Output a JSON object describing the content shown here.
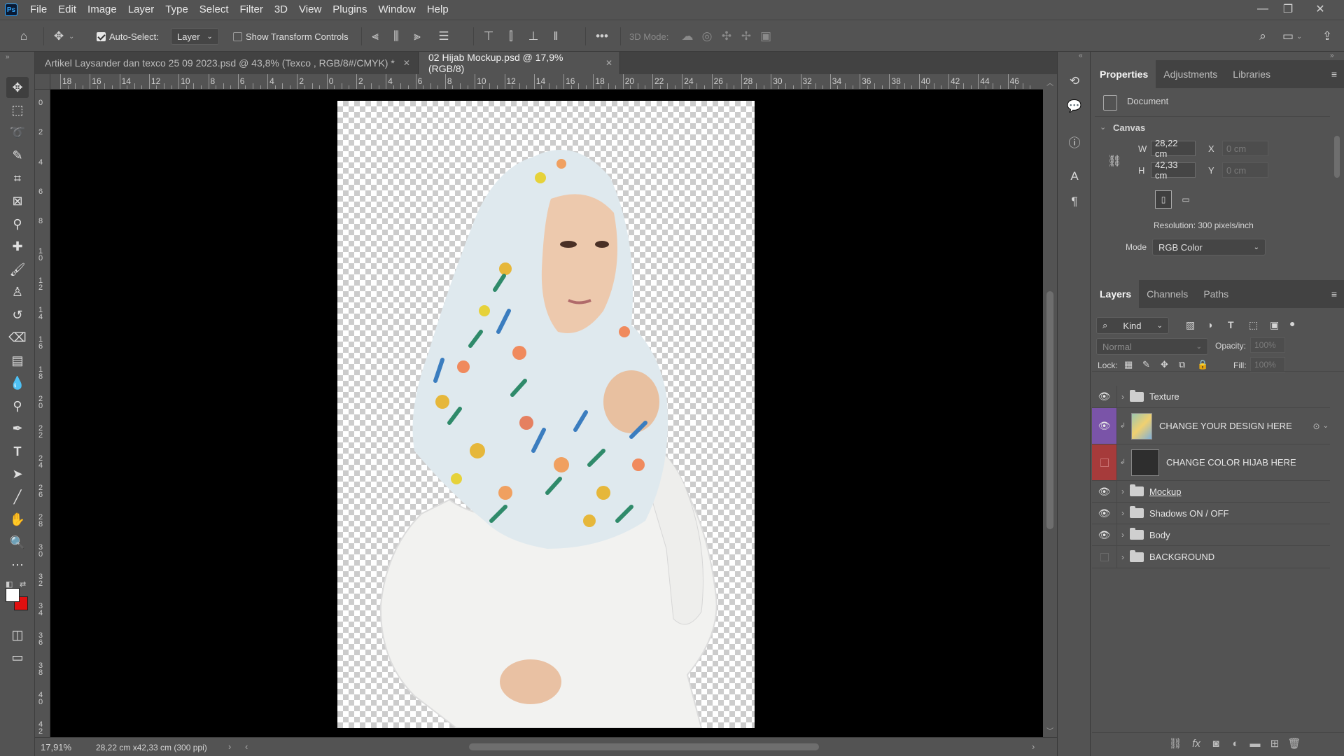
{
  "menubar": {
    "logo": "Ps",
    "items": [
      "File",
      "Edit",
      "Image",
      "Layer",
      "Type",
      "Select",
      "Filter",
      "3D",
      "View",
      "Plugins",
      "Window",
      "Help"
    ]
  },
  "options_bar": {
    "auto_select_label": "Auto-Select:",
    "auto_select_checked": true,
    "auto_select_target": "Layer",
    "show_transform_label": "Show Transform Controls",
    "show_transform_checked": false,
    "more_label": "•••",
    "mode_3d_label": "3D Mode:"
  },
  "tabs": [
    {
      "label": "Artikel Laysander dan texco 25 09 2023.psd @ 43,8% (Texco , RGB/8#/CMYK) *",
      "active": false
    },
    {
      "label": "02 Hijab Mockup.psd @ 17,9% (RGB/8)",
      "active": true
    }
  ],
  "ruler_top": [
    "18",
    "16",
    "14",
    "12",
    "10",
    "8",
    "6",
    "4",
    "2",
    "0",
    "2",
    "4",
    "6",
    "8",
    "10",
    "12",
    "14",
    "16",
    "18",
    "20",
    "22",
    "24",
    "26",
    "28",
    "30",
    "32",
    "34",
    "36",
    "38",
    "40",
    "42",
    "44",
    "46"
  ],
  "ruler_left": [
    "0",
    "2",
    "4",
    "6",
    "8",
    "1 0",
    "1 2",
    "1 4",
    "1 6",
    "1 8",
    "2 0",
    "2 2",
    "2 4",
    "2 6",
    "2 8",
    "3 0",
    "3 2",
    "3 4",
    "3 6",
    "3 8",
    "4 0",
    "4 2"
  ],
  "status": {
    "zoom": "17,91%",
    "doc_info": "28,22 cm x42,33 cm (300 ppi)"
  },
  "properties": {
    "tabs": [
      "Properties",
      "Adjustments",
      "Libraries"
    ],
    "document_label": "Document",
    "canvas_section": "Canvas",
    "w_label": "W",
    "w_value": "28,22 cm",
    "h_label": "H",
    "h_value": "42,33 cm",
    "x_label": "X",
    "x_placeholder": "0 cm",
    "y_label": "Y",
    "y_placeholder": "0 cm",
    "resolution": "Resolution: 300 pixels/inch",
    "mode_label": "Mode",
    "mode_value": "RGB Color"
  },
  "layers_panel": {
    "tabs": [
      "Layers",
      "Channels",
      "Paths"
    ],
    "filter_kind": "Kind",
    "blend_mode": "Normal",
    "opacity_label": "Opacity:",
    "opacity_value": "100%",
    "lock_label": "Lock:",
    "fill_label": "Fill:",
    "fill_value": "100%",
    "layers": [
      {
        "name": "Texture",
        "type": "group",
        "visible": true
      },
      {
        "name": "CHANGE YOUR DESIGN HERE",
        "type": "smart",
        "visible": true,
        "color": "#7a54a8"
      },
      {
        "name": "CHANGE COLOR HIJAB HERE",
        "type": "fill",
        "visible": false,
        "color": "#a63b3b"
      },
      {
        "name": "Mockup",
        "type": "group",
        "visible": true
      },
      {
        "name": "Shadows ON / OFF",
        "type": "group",
        "visible": true
      },
      {
        "name": "Body",
        "type": "group",
        "visible": true
      },
      {
        "name": "BACKGROUND",
        "type": "group",
        "visible": false
      }
    ]
  },
  "colors": {
    "accent_blue": "#31a8ff",
    "foreground": "#ffffff",
    "background": "#e01010"
  }
}
